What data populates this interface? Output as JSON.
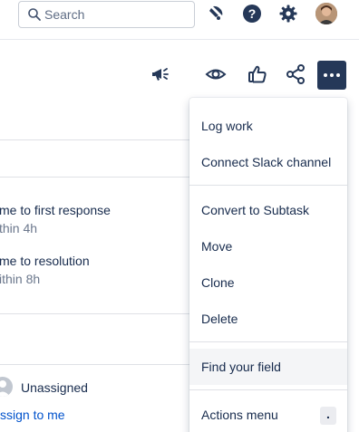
{
  "topbar": {
    "search_placeholder": "Search",
    "icons": [
      "search-icon",
      "notifications-icon",
      "help-icon",
      "settings-icon",
      "profile-avatar"
    ]
  },
  "toolbar": {
    "icons": [
      "announcement-icon",
      "watch-icon",
      "vote-icon",
      "share-icon",
      "more-actions-icon"
    ],
    "accent": "#253858"
  },
  "sla": [
    {
      "label": "me to first response",
      "value": "thin 4h"
    },
    {
      "label": "me to resolution",
      "value": "ithin 8h"
    }
  ],
  "assignee": {
    "value": "Unassigned",
    "assign_link": "ssign to me"
  },
  "menu": {
    "groups": [
      [
        "Log work",
        "Connect Slack channel"
      ],
      [
        "Convert to Subtask",
        "Move",
        "Clone",
        "Delete"
      ],
      [
        "Find your field"
      ],
      [
        "Actions menu"
      ]
    ],
    "items": {
      "log_work": "Log work",
      "connect_slack": "Connect Slack channel",
      "convert_subtask": "Convert to Subtask",
      "move": "Move",
      "clone": "Clone",
      "delete": "Delete",
      "find_field": "Find your field",
      "actions_menu": "Actions menu"
    },
    "shortcut": ".",
    "highlighted": "Find your field"
  },
  "colors": {
    "link": "#0052cc",
    "text": "#172b4d",
    "muted": "#6b778c",
    "border": "#dfe1e6"
  }
}
